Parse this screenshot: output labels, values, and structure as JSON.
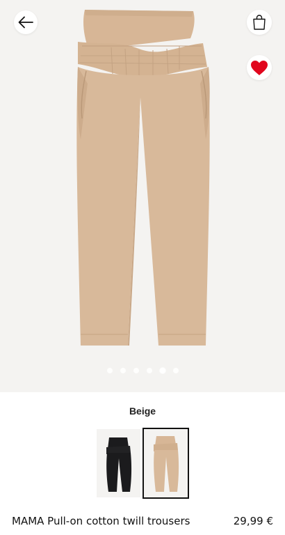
{
  "header": {
    "back_icon": "arrow-left-icon",
    "bag_icon": "shopping-bag-icon",
    "favourite_icon": "heart-icon",
    "favourite_color": "#e1061d"
  },
  "gallery": {
    "total_images": 6,
    "active_index": 4,
    "product_color": "#d8b99a"
  },
  "colors": {
    "selected_label": "Beige",
    "options": [
      {
        "name": "Black",
        "hex": "#1b1b1d",
        "selected": false
      },
      {
        "name": "Beige",
        "hex": "#d8b99a",
        "selected": true
      }
    ]
  },
  "product": {
    "title": "MAMA Pull-on cotton twill trousers",
    "price": "29,99 €"
  }
}
